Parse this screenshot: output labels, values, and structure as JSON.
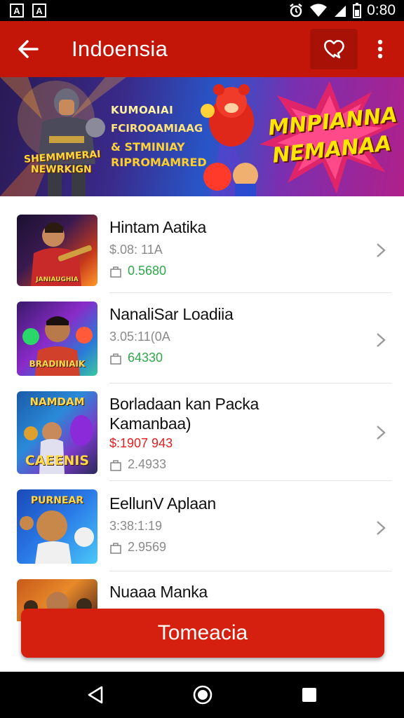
{
  "status_bar": {
    "notif_icons": [
      "A",
      "A"
    ],
    "time": "0:80"
  },
  "app_bar": {
    "title": "Indoensia"
  },
  "banner": {
    "line1": "KUMOAIAI",
    "line2": "FCIROOAMIAAG",
    "line3": "& STMINIAY",
    "line4": "RIPROMAMRED",
    "hero_label1": "SHEMMMERAI",
    "hero_label2": "NEWRKIGN",
    "big_line1": "MNPIANNA",
    "big_line2": "NEMANAA"
  },
  "games": [
    {
      "name": "Hintam Aatika",
      "meta": "$.08: 11A",
      "size": "0.5680",
      "size_color": "green",
      "thumb_label": "JANIAUGHIA"
    },
    {
      "name": "NanaliSar Loadiia",
      "meta": "3.05:11(0A",
      "size": "64330",
      "size_color": "green",
      "thumb_label": "BRADINIAIK"
    },
    {
      "name": "Borladaan kan Packa",
      "name2": "Kamanbaa)",
      "meta": "$:1907 943",
      "meta_color": "red",
      "size": "2.4933",
      "size_color": "gray",
      "thumb_label": "CAEENIS",
      "thumb_label_top": "NAMDAM"
    },
    {
      "name": "EellunV Aplaan",
      "meta": "3:38:1:19",
      "size": "2.9569",
      "size_color": "gray",
      "thumb_label": "PURNEAR"
    },
    {
      "name": "Nuaaa Manka",
      "meta": "",
      "size": "",
      "size_color": "gray",
      "thumb_label": ""
    }
  ],
  "cta": {
    "label": "Tomeacia"
  },
  "colors": {
    "primary": "#c41608",
    "primary_dark": "#a81206",
    "cta": "#d6200f",
    "price_green": "#2ea84a",
    "price_red": "#e02020"
  }
}
